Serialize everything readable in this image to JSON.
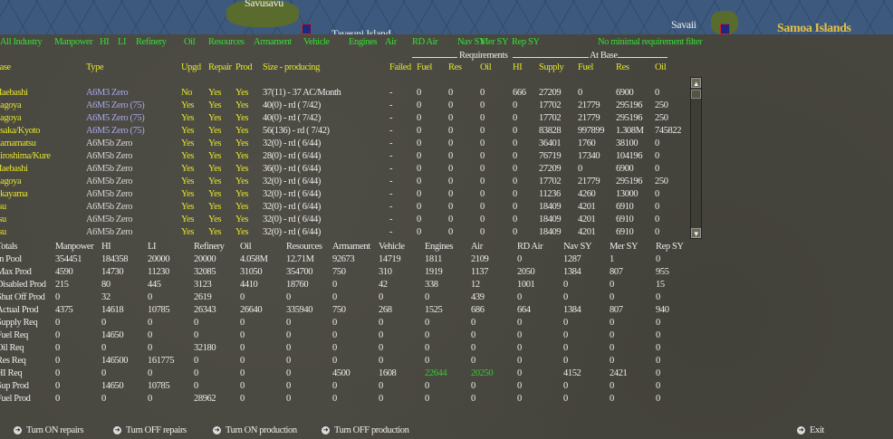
{
  "map": {
    "labels": [
      "Savusavu",
      "Taveuni Island",
      "Savaii"
    ],
    "region_title": "Samoa Islands"
  },
  "filters": [
    "All Industry",
    "Manpower",
    "HI",
    "LI",
    "Refinery",
    "Oil",
    "Resources",
    "Armament",
    "Vehicle",
    "Engines",
    "Air",
    "RD Air",
    "Nav SY",
    "Mer SY",
    "Rep SY",
    "No minimal requirement filter"
  ],
  "group_headers": {
    "requirements": "Requirements",
    "at_base": "At Base"
  },
  "factory_table": {
    "headers": [
      "Base",
      "Type",
      "Upgd",
      "Repair",
      "Prod",
      "Size - producing",
      "Failed",
      "Fuel",
      "Res",
      "Oil",
      "HI",
      "Supply",
      "Fuel",
      "Res",
      "Oil"
    ],
    "rows": [
      [
        "Maebashi",
        "A6M3 Zero",
        "No",
        "Yes",
        "Yes",
        "37(11) - 37 AC/Month",
        "-",
        "0",
        "0",
        "0",
        "666",
        "27209",
        "0",
        "6900",
        "0"
      ],
      [
        "Nagoya",
        "A6M5 Zero (75)",
        "Yes",
        "Yes",
        "Yes",
        "40(0) - rd ( 7/42)",
        "-",
        "0",
        "0",
        "0",
        "0",
        "17702",
        "21779",
        "295196",
        "250"
      ],
      [
        "Nagoya",
        "A6M5 Zero (75)",
        "Yes",
        "Yes",
        "Yes",
        "40(0) - rd ( 7/42)",
        "-",
        "0",
        "0",
        "0",
        "0",
        "17702",
        "21779",
        "295196",
        "250"
      ],
      [
        "Osaka/Kyoto",
        "A6M5 Zero (75)",
        "Yes",
        "Yes",
        "Yes",
        "56(136) - rd ( 7/42)",
        "-",
        "0",
        "0",
        "0",
        "0",
        "83828",
        "997899",
        "1.308M",
        "745822"
      ],
      [
        "Hamamatsu",
        "A6M5b Zero",
        "Yes",
        "Yes",
        "Yes",
        "32(0) - rd ( 6/44)",
        "-",
        "0",
        "0",
        "0",
        "0",
        "36401",
        "1760",
        "38100",
        "0"
      ],
      [
        "Hiroshima/Kure",
        "A6M5b Zero",
        "Yes",
        "Yes",
        "Yes",
        "28(0) - rd ( 6/44)",
        "-",
        "0",
        "0",
        "0",
        "0",
        "76719",
        "17340",
        "104196",
        "0"
      ],
      [
        "Maebashi",
        "A6M5b Zero",
        "Yes",
        "Yes",
        "Yes",
        "36(0) - rd ( 6/44)",
        "-",
        "0",
        "0",
        "0",
        "0",
        "27209",
        "0",
        "6900",
        "0"
      ],
      [
        "Nagoya",
        "A6M5b Zero",
        "Yes",
        "Yes",
        "Yes",
        "32(0) - rd ( 6/44)",
        "-",
        "0",
        "0",
        "0",
        "0",
        "17702",
        "21779",
        "295196",
        "250"
      ],
      [
        "Okayama",
        "A6M5b Zero",
        "Yes",
        "Yes",
        "Yes",
        "32(0) - rd ( 6/44)",
        "-",
        "0",
        "0",
        "0",
        "0",
        "11236",
        "4260",
        "13000",
        "0"
      ],
      [
        "Tsu",
        "A6M5b Zero",
        "Yes",
        "Yes",
        "Yes",
        "32(0) - rd ( 6/44)",
        "-",
        "0",
        "0",
        "0",
        "0",
        "18409",
        "4201",
        "6910",
        "0"
      ],
      [
        "Tsu",
        "A6M5b Zero",
        "Yes",
        "Yes",
        "Yes",
        "32(0) - rd ( 6/44)",
        "-",
        "0",
        "0",
        "0",
        "0",
        "18409",
        "4201",
        "6910",
        "0"
      ],
      [
        "Tsu",
        "A6M5b Zero",
        "Yes",
        "Yes",
        "Yes",
        "32(0) - rd ( 6/44)",
        "-",
        "0",
        "0",
        "0",
        "0",
        "18409",
        "4201",
        "6910",
        "0"
      ]
    ]
  },
  "totals_table": {
    "headers": [
      "Totals",
      "Manpower",
      "HI",
      "LI",
      "Refinery",
      "Oil",
      "Resources",
      "Armament",
      "Vehicle",
      "Engines",
      "Air",
      "RD Air",
      "Nav SY",
      "Mer SY",
      "Rep SY"
    ],
    "rows": [
      [
        "In Pool",
        "354451",
        "184358",
        "20000",
        "20000",
        "4.058M",
        "12.71M",
        "92673",
        "14719",
        "1811",
        "2109",
        "0",
        "1287",
        "1",
        "0"
      ],
      [
        "Max Prod",
        "4590",
        "14730",
        "11230",
        "32085",
        "31050",
        "354700",
        "750",
        "310",
        "1919",
        "1137",
        "2050",
        "1384",
        "807",
        "955"
      ],
      [
        "Disabled Prod",
        "215",
        "80",
        "445",
        "3123",
        "4410",
        "18760",
        "0",
        "42",
        "338",
        "12",
        "1001",
        "0",
        "0",
        "15"
      ],
      [
        "Shut Off Prod",
        "0",
        "32",
        "0",
        "2619",
        "0",
        "0",
        "0",
        "0",
        "0",
        "439",
        "0",
        "0",
        "0",
        "0"
      ],
      [
        "Actual Prod",
        "4375",
        "14618",
        "10785",
        "26343",
        "26640",
        "335940",
        "750",
        "268",
        "1525",
        "686",
        "664",
        "1384",
        "807",
        "940"
      ],
      [
        "Supply Req",
        "0",
        "0",
        "0",
        "0",
        "0",
        "0",
        "0",
        "0",
        "0",
        "0",
        "0",
        "0",
        "0",
        "0"
      ],
      [
        "Fuel Req",
        "0",
        "14650",
        "0",
        "0",
        "0",
        "0",
        "0",
        "0",
        "0",
        "0",
        "0",
        "0",
        "0",
        "0"
      ],
      [
        "Oil Req",
        "0",
        "0",
        "0",
        "32180",
        "0",
        "0",
        "0",
        "0",
        "0",
        "0",
        "0",
        "0",
        "0",
        "0"
      ],
      [
        "Res Req",
        "0",
        "146500",
        "161775",
        "0",
        "0",
        "0",
        "0",
        "0",
        "0",
        "0",
        "0",
        "0",
        "0",
        "0"
      ],
      [
        "HI Req",
        "0",
        "0",
        "0",
        "0",
        "0",
        "0",
        "4500",
        "1608",
        "22644",
        "20250",
        "0",
        "4152",
        "2421",
        "0"
      ],
      [
        "Sup Prod",
        "0",
        "14650",
        "10785",
        "0",
        "0",
        "0",
        "0",
        "0",
        "0",
        "0",
        "0",
        "0",
        "0",
        "0"
      ],
      [
        "Fuel Prod",
        "0",
        "0",
        "0",
        "28962",
        "0",
        "0",
        "0",
        "0",
        "0",
        "0",
        "0",
        "0",
        "0",
        "0"
      ]
    ],
    "highlight": {
      "row": 9,
      "cols": [
        9,
        10
      ],
      "color": "#33cc33"
    }
  },
  "actions": [
    "Turn ON repairs",
    "Turn OFF repairs",
    "Turn ON production",
    "Turn OFF production",
    "Exit"
  ],
  "colors": {
    "header": "#e4e42c",
    "filter": "#33e033",
    "value": "#ececec",
    "type_named": "#a8a8ee"
  }
}
